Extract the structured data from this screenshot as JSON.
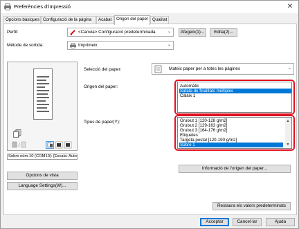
{
  "window": {
    "title": "Preferències d'impressió",
    "close": "✕"
  },
  "tabs": [
    {
      "label": "Opcions bàsiques"
    },
    {
      "label": "Configuració de la pàgina"
    },
    {
      "label": "Acabat"
    },
    {
      "label": "Origen del paper"
    },
    {
      "label": "Qualitat"
    }
  ],
  "profile": {
    "label": "Perfil:",
    "value": "<Canvia> Configuració predeterminada",
    "add_button": "Afegeix(1)...",
    "edit_button": "Edita(2)..."
  },
  "output_method": {
    "label": "Mètode de sortida:",
    "value": "Imprimeix"
  },
  "paper_selection": {
    "label": "Selecció del paper:",
    "value": "Mateix paper per a totes les pàgines"
  },
  "paper_source": {
    "label": "Origen del paper:",
    "options": [
      "Automàtic",
      "Safata de finalitats múltiples",
      "Calaix 1"
    ],
    "selected_index": 1
  },
  "paper_type": {
    "label": "Tipus de paper(Y):",
    "options": [
      "Gruixut 1 [120-128 g/m2]",
      "Gruixut 2 [129-163 g/m2]",
      "Gruixut 3 [164-176 g/m2]",
      "Etiquetes",
      "Targeta postal [120-190 g/m2]",
      "Sobre 1"
    ],
    "selected_index": 5
  },
  "info_button": "Informació de l'origen del paper...",
  "preview_status": "Sobre núm.10 (COM10): [Escala: Auto",
  "view_options_button": "Opcions de vista",
  "language_button": "Language Settings(W)...",
  "restore_button": "Restaura els valors predeterminats",
  "footer": {
    "ok": "Acceptar",
    "cancel": "Cancel·lar",
    "help": "Ajuda"
  },
  "colors": {
    "selection": "#0078d7",
    "highlight": "#e01020"
  }
}
